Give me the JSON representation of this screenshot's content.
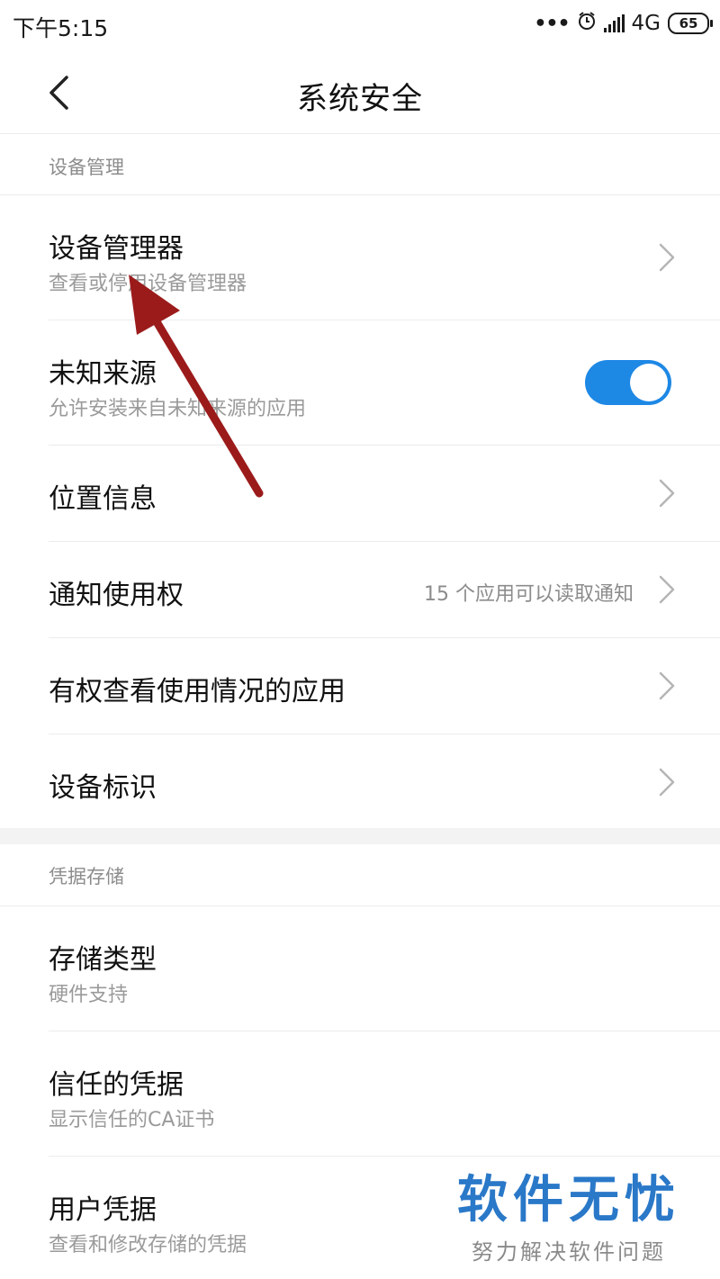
{
  "status_bar": {
    "time": "下午5:15",
    "network": "4G",
    "battery": "65",
    "icons": [
      "more-dots-icon",
      "alarm-icon",
      "signal-icon",
      "battery-icon"
    ]
  },
  "nav": {
    "title": "系统安全",
    "back_icon": "chevron-left-icon"
  },
  "sections": [
    {
      "header": "设备管理",
      "items": [
        {
          "title": "设备管理器",
          "subtitle": "查看或停用设备管理器",
          "accessory": "chevron"
        },
        {
          "title": "未知来源",
          "subtitle": "允许安装来自未知来源的应用",
          "accessory": "toggle",
          "toggle_on": true
        },
        {
          "title": "位置信息",
          "accessory": "chevron"
        },
        {
          "title": "通知使用权",
          "value": "15 个应用可以读取通知",
          "accessory": "chevron"
        },
        {
          "title": "有权查看使用情况的应用",
          "accessory": "chevron"
        },
        {
          "title": "设备标识",
          "accessory": "chevron"
        }
      ]
    },
    {
      "header": "凭据存储",
      "items": [
        {
          "title": "存储类型",
          "subtitle": "硬件支持"
        },
        {
          "title": "信任的凭据",
          "subtitle": "显示信任的CA证书"
        },
        {
          "title": "用户凭据",
          "subtitle": "查看和修改存储的凭据"
        }
      ]
    }
  ],
  "watermark": {
    "title": "软件无忧",
    "subtitle": "努力解决软件问题"
  },
  "colors": {
    "toggle_on": "#1e88e5",
    "annotation_arrow": "#9b1b1b",
    "watermark": "#2a78c8"
  }
}
